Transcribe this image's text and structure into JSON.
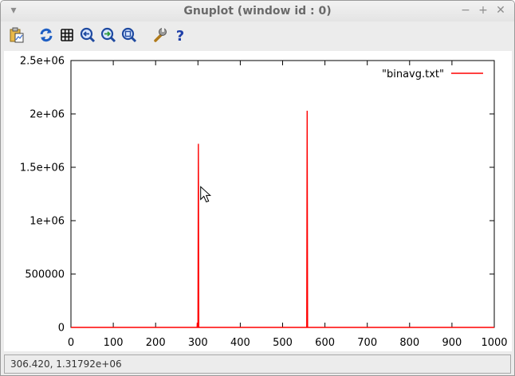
{
  "window": {
    "title": "Gnuplot (window id : 0)",
    "controls": {
      "menu_glyph": "▾",
      "minimize_glyph": "−",
      "maximize_glyph": "+",
      "close_glyph": "✕"
    }
  },
  "toolbar": {
    "items": [
      {
        "icon": "clipboard-icon"
      },
      {
        "icon": "replot-icon"
      },
      {
        "icon": "grid-icon"
      },
      {
        "icon": "zoom-back-icon"
      },
      {
        "icon": "zoom-forward-icon"
      },
      {
        "icon": "autoscale-icon"
      },
      {
        "icon": "wrench-icon"
      },
      {
        "icon": "help-icon"
      }
    ]
  },
  "chart_data": {
    "type": "line",
    "xlim": [
      0,
      1000
    ],
    "ylim": [
      0,
      2500000
    ],
    "x_ticks": [
      0,
      100,
      200,
      300,
      400,
      500,
      600,
      700,
      800,
      900,
      1000
    ],
    "x_tick_labels": [
      "0",
      "100",
      "200",
      "300",
      "400",
      "500",
      "600",
      "700",
      "800",
      "900",
      "1000"
    ],
    "y_ticks": [
      0,
      500000,
      1000000,
      1500000,
      2000000,
      2500000
    ],
    "y_tick_labels": [
      "0",
      "500000",
      "1e+06",
      "1.5e+06",
      "2e+06",
      "2.5e+06"
    ],
    "grid": false,
    "legend_position": "top-right",
    "series": [
      {
        "name": "\"binavg.txt\"",
        "color": "#ff0000",
        "points": [
          [
            0,
            0
          ],
          [
            298,
            0
          ],
          [
            298.5,
            45000
          ],
          [
            299,
            0
          ],
          [
            300,
            0
          ],
          [
            301,
            1720000
          ],
          [
            302,
            0
          ],
          [
            557,
            0
          ],
          [
            558,
            2030000
          ],
          [
            559,
            0
          ],
          [
            1000,
            0
          ]
        ]
      }
    ],
    "pointer": {
      "shape": "arrow-cursor",
      "x": 306.42,
      "y": 1317920
    }
  },
  "status": {
    "text": "306.420,  1.31792e+06"
  }
}
